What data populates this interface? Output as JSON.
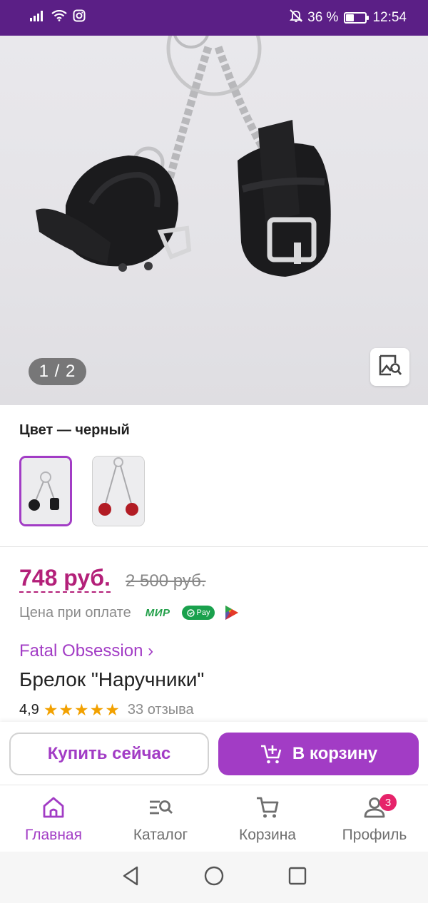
{
  "status_bar": {
    "battery_percent": "36 %",
    "time": "12:54",
    "battery_level": 0.36
  },
  "gallery": {
    "counter": "1 / 2"
  },
  "product": {
    "color_label": "Цвет — черный",
    "price": "748 руб.",
    "old_price": "2 500 руб.",
    "payment_note": "Цена при оплате",
    "payment_mir": "МИР",
    "payment_pay": "Pay",
    "brand": "Fatal Obsession ›",
    "title": "Брелок \"Наручники\"",
    "rating": "4,9",
    "stars": "★★★★★",
    "reviews": "33 отзыва",
    "swatches": [
      "черный",
      "красный"
    ]
  },
  "actions": {
    "buy_now": "Купить сейчас",
    "add_to_cart": "В корзину"
  },
  "tabs": [
    {
      "label": "Главная",
      "icon": "home-icon",
      "active": true
    },
    {
      "label": "Каталог",
      "icon": "catalog-search-icon"
    },
    {
      "label": "Корзина",
      "icon": "cart-icon"
    },
    {
      "label": "Профиль",
      "icon": "profile-icon",
      "badge": "3"
    }
  ],
  "colors": {
    "accent": "#a23cc5",
    "price": "#b32079",
    "status_bar": "#5b1f86",
    "badge": "#e6236a",
    "star": "#f2a100"
  }
}
